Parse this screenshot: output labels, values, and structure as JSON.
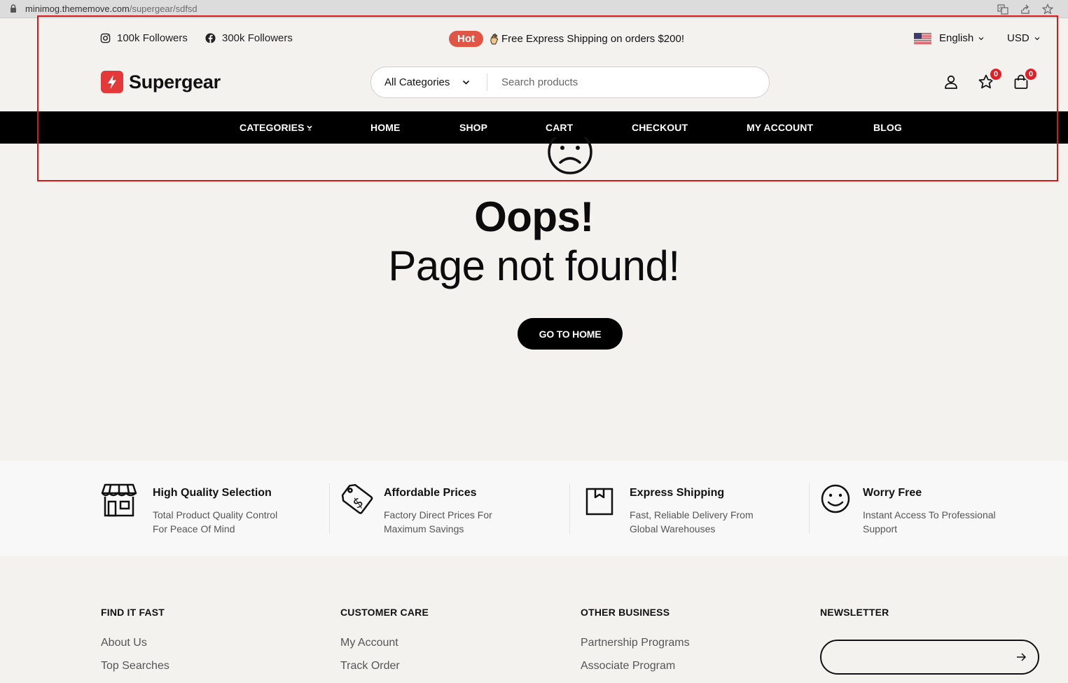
{
  "browser": {
    "url_host": "minimog.thememove.com",
    "url_path": "/supergear/sdfsd",
    "icons": [
      "lock-icon",
      "translate-icon",
      "share-icon",
      "bookmark-star-icon"
    ]
  },
  "topbar": {
    "instagram_label": "100k Followers",
    "facebook_label": "300k Followers",
    "hot_badge": "Hot",
    "promo_text": "Free Express Shipping on orders $200!",
    "language": "English",
    "currency": "USD"
  },
  "header": {
    "logo_text": "Supergear",
    "category_select": "All Categories",
    "search_placeholder": "Search products",
    "wishlist_count": "0",
    "cart_count": "0"
  },
  "nav": {
    "items": [
      {
        "label": "CATEGORIES"
      },
      {
        "label": "HOME"
      },
      {
        "label": "SHOP"
      },
      {
        "label": "CART"
      },
      {
        "label": "CHECKOUT"
      },
      {
        "label": "MY ACCOUNT"
      },
      {
        "label": "BLOG"
      }
    ]
  },
  "error": {
    "title": "Oops!",
    "subtitle": "Page not found!",
    "button": "GO TO HOME"
  },
  "features": [
    {
      "title": "High Quality Selection",
      "desc": "Total Product Quality Control For Peace Of Mind",
      "icon": "store-icon"
    },
    {
      "title": "Affordable Prices",
      "desc": "Factory Direct Prices For Maximum Savings",
      "icon": "price-tag-icon"
    },
    {
      "title": "Express Shipping",
      "desc": "Fast, Reliable Delivery From Global Warehouses",
      "icon": "box-icon"
    },
    {
      "title": "Worry Free",
      "desc": "Instant Access To Professional Support",
      "icon": "smile-icon"
    }
  ],
  "footer": {
    "find_it_fast": {
      "heading": "FIND IT FAST",
      "links": [
        "About Us",
        "Top Searches"
      ]
    },
    "customer_care": {
      "heading": "CUSTOMER CARE",
      "links": [
        "My Account",
        "Track Order"
      ]
    },
    "other_business": {
      "heading": "OTHER BUSINESS",
      "links": [
        "Partnership Programs",
        "Associate Program"
      ]
    },
    "newsletter": {
      "heading": "NEWSLETTER",
      "placeholder": ""
    }
  },
  "colors": {
    "accent": "#e4393a",
    "hot_badge": "#e05545",
    "badge": "#e41e26",
    "nav_bg": "#000000",
    "page_bg": "#f4f2ee",
    "annotation": "#d81818"
  }
}
